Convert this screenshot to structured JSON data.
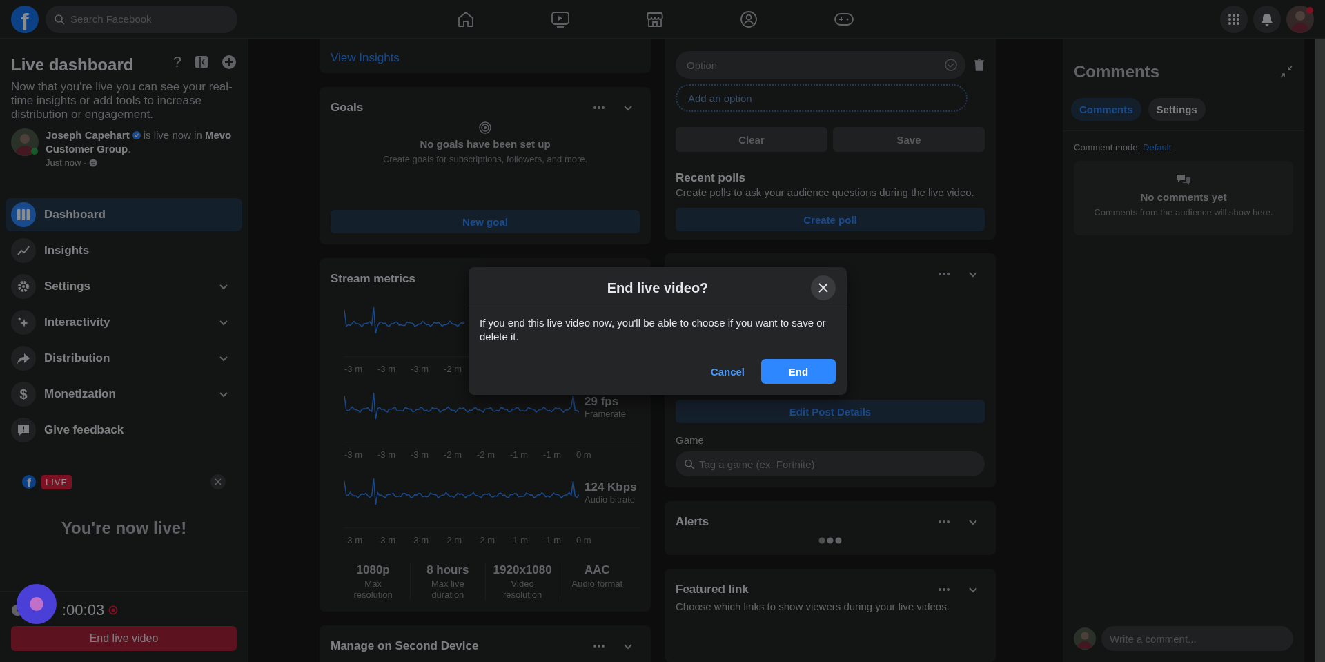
{
  "top_bar": {
    "logo": "f",
    "search": {
      "placeholder": "Search Facebook"
    }
  },
  "sidebar": {
    "title": "Live dashboard",
    "help": "?",
    "description": "Now that you're live you can see your real-time insights or add tools to increase distribution or engagement.",
    "author": "Joseph Capehart",
    "status": "is live now in **Mevo**",
    "status_continued": "**Customer Group**.",
    "time": "Just now ·",
    "nav_items": [
      {
        "label": "Dashboard",
        "selected": true,
        "expandable": false
      },
      {
        "label": "Insights",
        "selected": false,
        "expandable": false
      },
      {
        "label": "Settings",
        "selected": false,
        "expandable": true
      },
      {
        "label": "Interactivity",
        "selected": false,
        "expandable": true
      },
      {
        "label": "Distribution",
        "selected": false,
        "expandable": true
      },
      {
        "label": "Monetization",
        "selected": false,
        "expandable": true,
        "icon_text": "$"
      },
      {
        "label": "Give feedback",
        "selected": false,
        "expandable": false
      }
    ],
    "live_card": {
      "logo": "f",
      "badge": "LIVE",
      "message": "You're now live!"
    },
    "timer": ":00:03",
    "end_button": "End live video"
  },
  "insights_link": "View Insights",
  "goals": {
    "title": "Goals",
    "empty_title": "No goals have been set up",
    "empty_text": "Create goals for subscriptions, followers, and more.",
    "button": "New goal"
  },
  "stream_metrics": {
    "title": "Stream metrics",
    "graphs": [
      {
        "ticks": [
          "-3 m",
          "-3 m",
          "-3 m",
          "-2 m"
        ]
      },
      {
        "reading": "29 fps",
        "label": "Framerate",
        "ticks": [
          "-3 m",
          "-3 m",
          "-3 m",
          "-2 m",
          "-2 m",
          "-1 m",
          "-1 m",
          "0 m"
        ]
      },
      {
        "reading": "124 Kbps",
        "label": "Audio bitrate",
        "ticks": [
          "-3 m",
          "-3 m",
          "-3 m",
          "-2 m",
          "-2 m",
          "-1 m",
          "-1 m",
          "0 m"
        ]
      }
    ],
    "stats": [
      {
        "value": "1080p",
        "label": "Max resolution"
      },
      {
        "value": "8 hours",
        "label": "Max live duration"
      },
      {
        "value": "1920x1080",
        "label": "Video resolution"
      },
      {
        "value": "AAC",
        "label": "Audio format"
      }
    ]
  },
  "second_device": {
    "title": "Manage on Second Device"
  },
  "poll": {
    "option_placeholder": "Option",
    "add_option": "Add an option",
    "actions": [
      {
        "label": "Clear",
        "disabled": true
      },
      {
        "label": "Save",
        "disabled": true
      }
    ],
    "recent_title": "Recent polls",
    "recent_text": "Create polls to ask your audience questions during the live video.",
    "create_button": "Create poll"
  },
  "post_details": {
    "edit_button": "Edit Post Details",
    "game_label": "Game",
    "game_placeholder": "Tag a game (ex: Fortnite)"
  },
  "alerts": {
    "title": "Alerts",
    "loading": true
  },
  "featured_link": {
    "title": "Featured link",
    "description": "Choose which links to show viewers during your live videos."
  },
  "comments": {
    "title": "Comments",
    "tabs": [
      {
        "label": "Comments",
        "selected": true
      },
      {
        "label": "Settings",
        "selected": false
      }
    ],
    "mode_label": "Comment mode:",
    "mode_value": "Default",
    "empty_title": "No comments yet",
    "empty_text": "Comments from the audience will show here.",
    "input_placeholder": "Write a comment..."
  },
  "dialog": {
    "title": "End live video?",
    "message": "If you end this live video now, you'll be able to choose if you want to save or delete it.",
    "cancel": "Cancel",
    "confirm": "End"
  }
}
